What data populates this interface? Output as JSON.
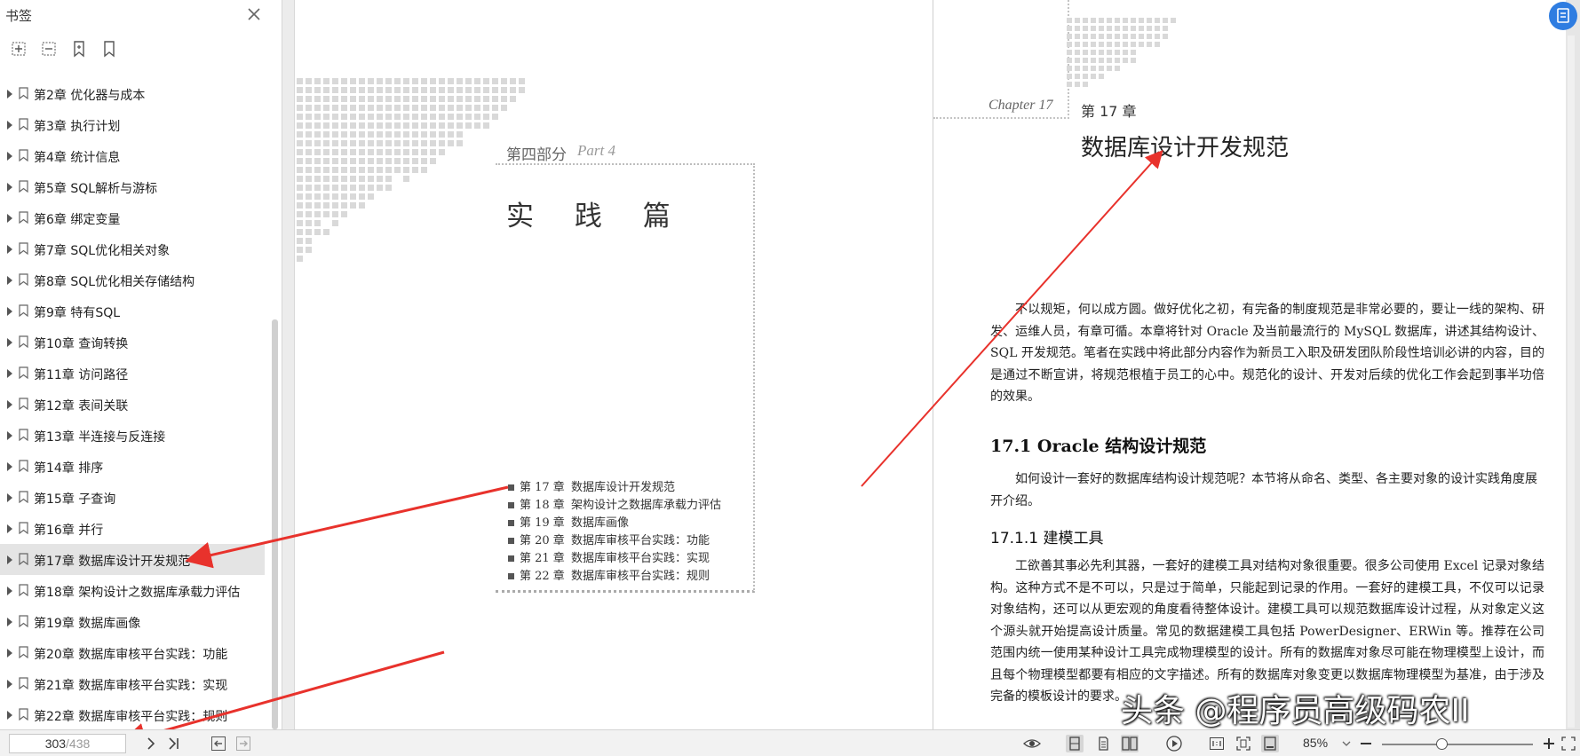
{
  "sidebar": {
    "title": "书签",
    "items": [
      {
        "label": "第2章 优化器与成本"
      },
      {
        "label": "第3章 执行计划"
      },
      {
        "label": "第4章 统计信息"
      },
      {
        "label": "第5章 SQL解析与游标"
      },
      {
        "label": "第6章 绑定变量"
      },
      {
        "label": "第7章 SQL优化相关对象"
      },
      {
        "label": "第8章 SQL优化相关存储结构"
      },
      {
        "label": "第9章 特有SQL"
      },
      {
        "label": "第10章 查询转换"
      },
      {
        "label": "第11章 访问路径"
      },
      {
        "label": "第12章 表间关联"
      },
      {
        "label": "第13章 半连接与反连接"
      },
      {
        "label": "第14章 排序"
      },
      {
        "label": "第15章 子查询"
      },
      {
        "label": "第16章 并行"
      },
      {
        "label": "第17章 数据库设计开发规范",
        "active": true
      },
      {
        "label": "第18章 架构设计之数据库承载力评估"
      },
      {
        "label": "第19章 数据库画像"
      },
      {
        "label": "第20章 数据库审核平台实践：功能"
      },
      {
        "label": "第21章 数据库审核平台实践：实现"
      },
      {
        "label": "第22章 数据库审核平台实践：规则"
      }
    ]
  },
  "left_page": {
    "part_label": "第四部分",
    "part_en": "Part 4",
    "heading": "实 践 篇",
    "toc": [
      {
        "num": "第 17 章",
        "title": "数据库设计开发规范"
      },
      {
        "num": "第 18 章",
        "title": "架构设计之数据库承载力评估"
      },
      {
        "num": "第 19 章",
        "title": "数据库画像"
      },
      {
        "num": "第 20 章",
        "title": "数据库审核平台实践：功能"
      },
      {
        "num": "第 21 章",
        "title": "数据库审核平台实践：实现"
      },
      {
        "num": "第 22 章",
        "title": "数据库审核平台实践：规则"
      }
    ]
  },
  "right_page": {
    "chapter_en": "Chapter 17",
    "chapter_cn": "第 17 章",
    "title": "数据库设计开发规范",
    "intro": "不以规矩，何以成方圆。做好优化之初，有完备的制度规范是非常必要的，要让一线的架构、研发、运维人员，有章可循。本章将针对 Oracle 及当前最流行的 MySQL 数据库，讲述其结构设计、SQL 开发规范。笔者在实践中将此部分内容作为新员工入职及研发团队阶段性培训必讲的内容，目的是通过不断宣讲，将规范根植于员工的心中。规范化的设计、开发对后续的优化工作会起到事半功倍的效果。",
    "section_title": "17.1 Oracle 结构设计规范",
    "section_text": "如何设计一套好的数据库结构设计规范呢？本节将从命名、类型、各主要对象的设计实践角度展开介绍。",
    "subsection_title": "17.1.1 建模工具",
    "subsection_text": "工欲善其事必先利其器，一套好的建模工具对结构对象很重要。很多公司使用 Excel 记录对象结构。这种方式不是不可以，只是过于简单，只能起到记录的作用。一套好的建模工具，不仅可以记录对象结构，还可以从更宏观的角度看待整体设计。建模工具可以规范数据库设计过程，从对象定义这个源头就开始提高设计质量。常见的数据建模工具包括 PowerDesigner、ERWin 等。推荐在公司范围内统一使用某种设计工具完成物理模型的设计。所有的数据库对象尽可能在物理模型上设计，而且每个物理模型都要有相应的文字描述。所有的数据库对象变更以数据库物理模型为基准，由于涉及完备的模板设计的要求。"
  },
  "watermark": "头条 @程序员高级码农II",
  "toolbar": {
    "current_page": "303",
    "total_pages": "/438",
    "zoom": "85%"
  },
  "colors": {
    "arrow": "#e8322c",
    "accent": "#2f7de1"
  }
}
